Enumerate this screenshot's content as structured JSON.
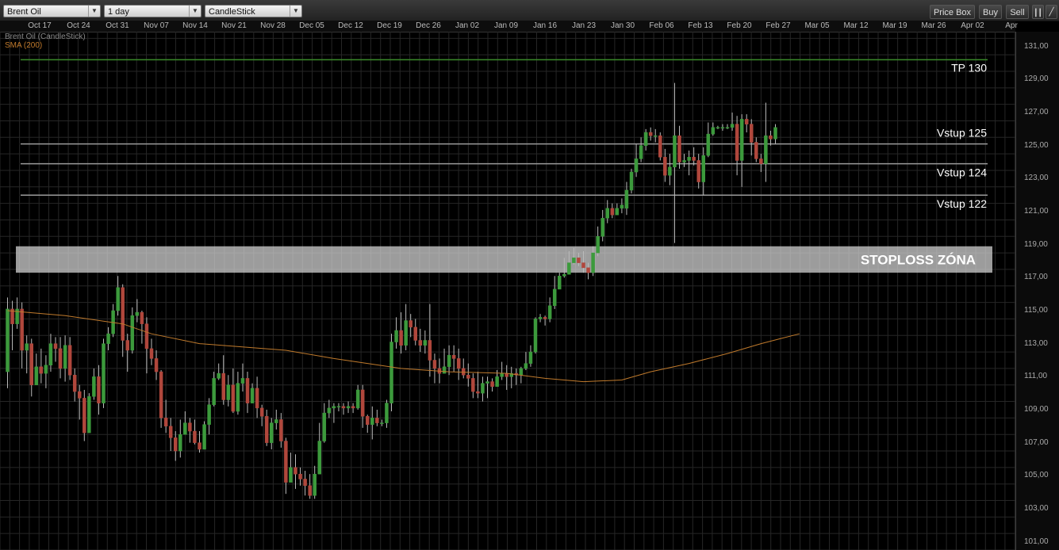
{
  "toolbar": {
    "instrument": "Brent Oil",
    "timeframe": "1 day",
    "chart_type": "CandleStick",
    "price_box_label": "Price Box",
    "buy_label": "Buy",
    "sell_label": "Sell"
  },
  "legend": {
    "series_label": "Brent Oil (CandleStick)",
    "sma_label": "SMA (200)"
  },
  "colors": {
    "up": "#3c9a3c",
    "down": "#b0473c",
    "sma": "#c07a2c",
    "tp_line": "#3a8a2a",
    "entry_line": "#9a9a9a",
    "grid": "#262626"
  },
  "chart_data": {
    "type": "candlestick",
    "x_ticks": [
      "Oct 17",
      "Oct 24",
      "Oct 31",
      "Nov 07",
      "Nov 14",
      "Nov 21",
      "Nov 28",
      "Dec 05",
      "Dec 12",
      "Dec 19",
      "Dec 26",
      "Jan 02",
      "Jan 09",
      "Jan 16",
      "Jan 23",
      "Jan 30",
      "Feb 06",
      "Feb 13",
      "Feb 20",
      "Feb 27",
      "Mar 05",
      "Mar 12",
      "Mar 19",
      "Mar 26",
      "Apr 02",
      "Apr"
    ],
    "y_ticks": [
      "131,00",
      "129,00",
      "127,00",
      "125,00",
      "123,00",
      "121,00",
      "119,00",
      "117,00",
      "115,00",
      "113,00",
      "111,00",
      "109,00",
      "107,00",
      "105,00",
      "103,00",
      "101,00"
    ],
    "ylim": [
      100.5,
      131.9
    ],
    "annotations": [
      {
        "label": "TP 130",
        "value": 130.2,
        "kind": "tp"
      },
      {
        "label": "Vstup 125",
        "value": 125.1,
        "kind": "entry"
      },
      {
        "label": "Vstup 124",
        "value": 123.9,
        "kind": "entry"
      },
      {
        "label": "Vstup 122",
        "value": 122.0,
        "kind": "entry"
      }
    ],
    "stoploss_zone": {
      "label": "STOPLOSS ZÓNA",
      "from": 117.3,
      "to": 118.9
    },
    "candles": [
      [
        111.3,
        115.1,
        115.8,
        110.3
      ],
      [
        115.1,
        114.2,
        115.6,
        112.6
      ],
      [
        114.2,
        115.1,
        115.8,
        113.9
      ],
      [
        115.1,
        112.6,
        115.5,
        111.5
      ],
      [
        112.6,
        113.0,
        113.5,
        111.2
      ],
      [
        113.0,
        110.5,
        113.3,
        109.8
      ],
      [
        110.5,
        111.6,
        112.4,
        110.6
      ],
      [
        111.6,
        111.2,
        112.7,
        110.6
      ],
      [
        111.2,
        111.7,
        112.3,
        110.3
      ],
      [
        111.7,
        113.0,
        113.6,
        111.3
      ],
      [
        113.0,
        112.7,
        113.4,
        111.9
      ],
      [
        112.7,
        111.5,
        113.4,
        110.9
      ],
      [
        111.5,
        112.9,
        113.5,
        110.7
      ],
      [
        112.9,
        111.1,
        113.4,
        110.8
      ],
      [
        111.1,
        110.1,
        111.5,
        109.5
      ],
      [
        110.1,
        109.7,
        110.5,
        108.4
      ],
      [
        109.7,
        107.6,
        110.2,
        107.1
      ],
      [
        107.6,
        109.8,
        110.0,
        109.1
      ],
      [
        109.8,
        111.0,
        111.5,
        109.6
      ],
      [
        111.0,
        109.4,
        111.7,
        108.7
      ],
      [
        109.4,
        113.0,
        113.3,
        109.1
      ],
      [
        113.0,
        113.6,
        114.0,
        112.6
      ],
      [
        113.6,
        115.0,
        115.4,
        113.4
      ],
      [
        115.0,
        116.4,
        117.1,
        114.7
      ],
      [
        116.4,
        113.2,
        116.6,
        112.2
      ],
      [
        113.2,
        112.6,
        113.6,
        111.3
      ],
      [
        112.6,
        114.7,
        115.2,
        112.4
      ],
      [
        114.7,
        114.9,
        115.7,
        114.3
      ],
      [
        114.9,
        114.2,
        115.0,
        113.0
      ],
      [
        114.2,
        112.7,
        114.6,
        111.2
      ],
      [
        112.7,
        112.1,
        113.3,
        111.7
      ],
      [
        112.1,
        111.3,
        112.6,
        110.8
      ],
      [
        111.3,
        108.5,
        111.4,
        107.9
      ],
      [
        108.5,
        108.0,
        109.6,
        107.6
      ],
      [
        108.0,
        107.3,
        108.5,
        106.5
      ],
      [
        107.3,
        106.5,
        107.7,
        105.9
      ],
      [
        106.5,
        107.5,
        108.4,
        106.1
      ],
      [
        107.5,
        108.2,
        108.9,
        107.8
      ],
      [
        108.2,
        107.7,
        108.5,
        107.0
      ],
      [
        107.7,
        107.0,
        108.4,
        106.9
      ],
      [
        107.0,
        106.6,
        107.7,
        106.4
      ],
      [
        106.6,
        108.1,
        108.3,
        106.6
      ],
      [
        108.1,
        109.3,
        109.7,
        107.5
      ],
      [
        109.3,
        110.9,
        111.3,
        109.2
      ],
      [
        110.9,
        111.2,
        111.8,
        110.8
      ],
      [
        111.2,
        109.6,
        112.3,
        109.3
      ],
      [
        109.6,
        110.5,
        111.1,
        109.2
      ],
      [
        110.5,
        108.9,
        111.5,
        108.8
      ],
      [
        108.9,
        110.6,
        111.3,
        108.7
      ],
      [
        110.6,
        110.9,
        111.8,
        110.1
      ],
      [
        110.9,
        109.4,
        111.3,
        108.8
      ],
      [
        109.4,
        110.3,
        110.6,
        109.6
      ],
      [
        110.3,
        109.1,
        111.0,
        108.5
      ],
      [
        109.1,
        108.6,
        109.3,
        108.0
      ],
      [
        108.6,
        107.0,
        109.0,
        106.8
      ],
      [
        107.0,
        108.2,
        108.5,
        106.6
      ],
      [
        108.2,
        108.4,
        109.0,
        107.8
      ],
      [
        108.4,
        107.1,
        108.8,
        106.7
      ],
      [
        107.1,
        104.6,
        107.3,
        103.9
      ],
      [
        104.6,
        105.5,
        106.4,
        105.1
      ],
      [
        105.5,
        105.1,
        106.3,
        104.2
      ],
      [
        105.1,
        104.8,
        105.5,
        104.4
      ],
      [
        104.8,
        104.4,
        105.3,
        103.8
      ],
      [
        104.4,
        103.8,
        105.1,
        103.6
      ],
      [
        103.8,
        105.1,
        105.6,
        103.6
      ],
      [
        105.1,
        107.1,
        108.2,
        105.2
      ],
      [
        107.1,
        108.8,
        109.4,
        107.0
      ],
      [
        108.8,
        109.1,
        109.6,
        108.5
      ],
      [
        109.1,
        109.2,
        109.4,
        108.2
      ],
      [
        109.2,
        109.2,
        109.4,
        108.9
      ],
      [
        109.2,
        109.1,
        109.4,
        108.7
      ],
      [
        109.1,
        109.2,
        109.5,
        108.8
      ],
      [
        109.2,
        109.1,
        109.4,
        108.8
      ],
      [
        109.1,
        110.2,
        110.5,
        109.0
      ],
      [
        110.2,
        108.6,
        110.5,
        107.9
      ],
      [
        108.6,
        108.1,
        108.7,
        107.6
      ],
      [
        108.1,
        108.5,
        109.2,
        107.2
      ],
      [
        108.5,
        108.2,
        109.0,
        108.0
      ],
      [
        108.2,
        108.2,
        108.4,
        108.0
      ],
      [
        108.2,
        109.4,
        109.6,
        107.9
      ],
      [
        109.4,
        113.1,
        113.6,
        108.9
      ],
      [
        113.1,
        113.8,
        114.6,
        112.7
      ],
      [
        113.8,
        112.9,
        114.9,
        112.4
      ],
      [
        112.9,
        114.4,
        115.4,
        112.6
      ],
      [
        114.4,
        114.0,
        114.8,
        113.4
      ],
      [
        114.0,
        113.2,
        114.5,
        112.9
      ],
      [
        113.2,
        112.9,
        113.9,
        112.5
      ],
      [
        112.9,
        113.2,
        113.8,
        112.4
      ],
      [
        113.2,
        112.0,
        115.4,
        111.0
      ],
      [
        112.0,
        111.5,
        112.4,
        110.6
      ],
      [
        111.5,
        111.2,
        112.1,
        110.6
      ],
      [
        111.2,
        111.6,
        112.7,
        111.5
      ],
      [
        111.6,
        112.3,
        112.9,
        111.1
      ],
      [
        112.3,
        112.1,
        112.9,
        111.3
      ],
      [
        112.1,
        111.5,
        112.7,
        110.8
      ],
      [
        111.5,
        111.1,
        112.1,
        110.9
      ],
      [
        111.1,
        110.9,
        111.8,
        110.4
      ],
      [
        110.9,
        110.1,
        111.2,
        109.7
      ],
      [
        110.1,
        110.0,
        111.3,
        109.7
      ],
      [
        110.0,
        110.6,
        111.0,
        109.5
      ],
      [
        110.6,
        110.7,
        111.0,
        109.7
      ],
      [
        110.7,
        110.4,
        110.9,
        110.1
      ],
      [
        110.4,
        111.0,
        111.4,
        110.5
      ],
      [
        111.0,
        111.2,
        111.9,
        110.8
      ],
      [
        111.2,
        111.0,
        111.7,
        110.2
      ],
      [
        111.0,
        111.2,
        111.6,
        110.3
      ],
      [
        111.2,
        111.1,
        111.5,
        110.5
      ],
      [
        111.1,
        111.5,
        111.6,
        110.6
      ],
      [
        111.5,
        111.8,
        112.5,
        111.4
      ],
      [
        111.8,
        112.5,
        112.9,
        111.6
      ],
      [
        112.5,
        114.5,
        114.6,
        112.4
      ],
      [
        114.5,
        114.6,
        114.8,
        114.3
      ],
      [
        114.6,
        114.5,
        114.7,
        114.1
      ],
      [
        114.5,
        115.3,
        115.8,
        114.3
      ],
      [
        115.3,
        116.3,
        117.1,
        115.1
      ],
      [
        116.3,
        117.1,
        117.3,
        116.4
      ],
      [
        117.1,
        117.2,
        118.2,
        117.0
      ],
      [
        117.2,
        117.9,
        118.6,
        117.5
      ],
      [
        117.9,
        118.2,
        118.8,
        117.8
      ],
      [
        118.2,
        117.9,
        118.5,
        117.7
      ],
      [
        117.9,
        117.6,
        118.6,
        117.3
      ],
      [
        117.6,
        117.3,
        117.9,
        116.9
      ],
      [
        117.3,
        118.5,
        118.9,
        117.1
      ],
      [
        118.5,
        119.5,
        120.1,
        118.3
      ],
      [
        119.5,
        120.6,
        121.1,
        119.2
      ],
      [
        120.6,
        121.2,
        121.7,
        120.3
      ],
      [
        121.2,
        120.8,
        121.5,
        120.6
      ],
      [
        120.8,
        121.2,
        121.5,
        120.8
      ],
      [
        121.2,
        121.4,
        121.8,
        120.9
      ],
      [
        121.2,
        122.3,
        122.8,
        120.8
      ],
      [
        122.3,
        123.4,
        123.6,
        122.1
      ],
      [
        123.4,
        124.2,
        125.1,
        123.1
      ],
      [
        124.2,
        125.0,
        125.5,
        124.0
      ],
      [
        125.0,
        125.8,
        126.0,
        124.7
      ],
      [
        125.8,
        125.6,
        126.1,
        125.3
      ],
      [
        125.6,
        125.6,
        126.0,
        125.2
      ],
      [
        125.6,
        124.3,
        125.8,
        124.1
      ],
      [
        124.3,
        123.2,
        124.8,
        122.8
      ],
      [
        123.2,
        123.7,
        124.5,
        122.6
      ],
      [
        123.7,
        125.6,
        128.8,
        119.1
      ],
      [
        125.6,
        124.0,
        126.2,
        123.6
      ],
      [
        124.0,
        124.1,
        124.5,
        123.7
      ],
      [
        124.1,
        124.3,
        124.7,
        123.2
      ],
      [
        124.3,
        124.1,
        124.9,
        123.8
      ],
      [
        124.1,
        122.8,
        124.5,
        122.4
      ],
      [
        122.8,
        124.4,
        124.9,
        122.0
      ],
      [
        124.4,
        125.7,
        126.4,
        124.3
      ],
      [
        125.7,
        126.1,
        126.4,
        125.6
      ],
      [
        126.1,
        126.1,
        126.2,
        126.0
      ],
      [
        126.1,
        126.1,
        126.3,
        125.9
      ],
      [
        126.1,
        126.1,
        126.3,
        126.0
      ],
      [
        126.1,
        126.3,
        127.0,
        125.9
      ],
      [
        126.3,
        124.1,
        126.8,
        123.2
      ],
      [
        124.1,
        126.6,
        126.9,
        122.5
      ],
      [
        126.6,
        126.3,
        126.9,
        125.8
      ],
      [
        126.3,
        125.2,
        126.6,
        124.4
      ],
      [
        125.2,
        124.2,
        125.5,
        124.0
      ],
      [
        124.2,
        123.9,
        124.5,
        123.4
      ],
      [
        123.9,
        125.6,
        127.6,
        122.8
      ],
      [
        125.6,
        125.4,
        125.9,
        125.0
      ],
      [
        125.4,
        126.1,
        126.3,
        125.1
      ]
    ],
    "sma": [
      [
        0,
        115.0
      ],
      [
        12,
        114.7
      ],
      [
        24,
        114.2
      ],
      [
        30,
        113.6
      ],
      [
        40,
        113.0
      ],
      [
        58,
        112.6
      ],
      [
        68,
        112.1
      ],
      [
        82,
        111.5
      ],
      [
        92,
        111.3
      ],
      [
        104,
        111.2
      ],
      [
        112,
        110.9
      ],
      [
        120,
        110.7
      ],
      [
        128,
        110.8
      ],
      [
        134,
        111.3
      ],
      [
        142,
        111.8
      ],
      [
        150,
        112.4
      ],
      [
        157,
        113.0
      ],
      [
        161,
        113.3
      ],
      [
        165,
        113.6
      ]
    ]
  }
}
